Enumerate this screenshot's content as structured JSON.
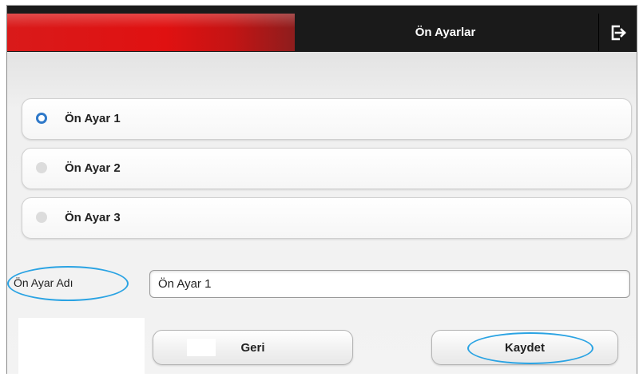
{
  "header": {
    "title": "Ön Ayarlar",
    "exit_icon": "exit-icon",
    "accent_color": "#e01111"
  },
  "presets": [
    {
      "label": "Ön Ayar 1",
      "selected": true
    },
    {
      "label": "Ön Ayar 2",
      "selected": false
    },
    {
      "label": "Ön Ayar 3",
      "selected": false
    }
  ],
  "name_field": {
    "label": "Ön Ayar Adı",
    "value": "Ön Ayar 1"
  },
  "buttons": {
    "back_label": "Geri",
    "save_label": "Kaydet"
  },
  "colors": {
    "radio_selected": "#2f79c9",
    "annotation": "#2aa3e3"
  }
}
